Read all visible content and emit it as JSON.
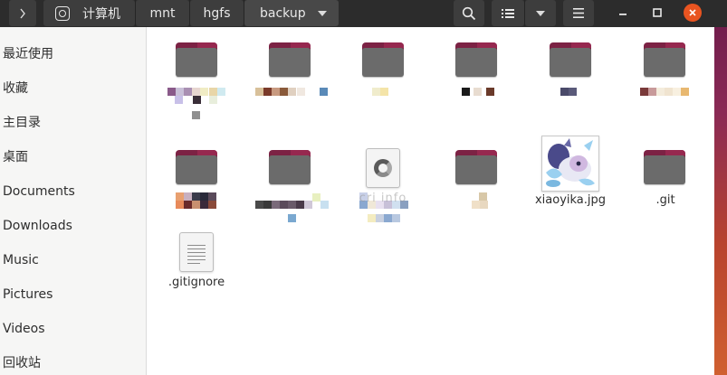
{
  "header": {
    "breadcrumbs": [
      "计算机",
      "mnt",
      "hgfs",
      "backup"
    ]
  },
  "sidebar": {
    "items": [
      {
        "label": "最近使用"
      },
      {
        "label": "收藏"
      },
      {
        "label": "主目录"
      },
      {
        "label": "桌面"
      },
      {
        "label": "Documents"
      },
      {
        "label": "Downloads"
      },
      {
        "label": "Music"
      },
      {
        "label": "Pictures"
      },
      {
        "label": "Videos"
      },
      {
        "label": "回收站"
      }
    ]
  },
  "files": {
    "json_partial_label": "cri info",
    "image_label": "xiaoyika.jpg",
    "git_label": ".git",
    "gitignore_label": ".gitignore"
  },
  "colors": {
    "accent": "#e95420",
    "folder_tab": "#7c2244",
    "folder_body": "#6b6b6b",
    "header_bg": "#2c2c2c"
  }
}
